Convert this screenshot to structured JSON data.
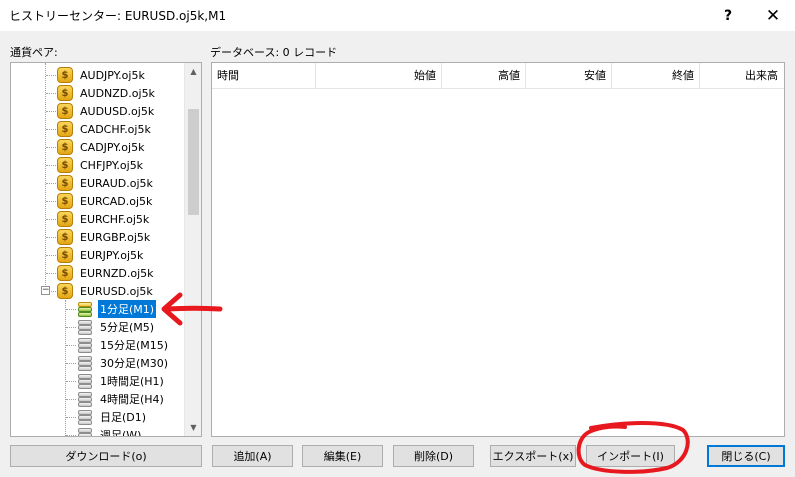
{
  "window": {
    "title": "ヒストリーセンター: EURUSD.oj5k,M1",
    "help_glyph": "?",
    "close_glyph": "✕"
  },
  "left_panel": {
    "label": "通貨ペア:",
    "symbols": [
      "AUDJPY.oj5k",
      "AUDNZD.oj5k",
      "AUDUSD.oj5k",
      "CADCHF.oj5k",
      "CADJPY.oj5k",
      "CHFJPY.oj5k",
      "EURAUD.oj5k",
      "EURCAD.oj5k",
      "EURCHF.oj5k",
      "EURGBP.oj5k",
      "EURJPY.oj5k",
      "EURNZD.oj5k",
      "EURUSD.oj5k"
    ],
    "coin_glyph": "$",
    "expanded_toggle": "−",
    "timeframes": [
      "1分足(M1)",
      "5分足(M5)",
      "15分足(M15)",
      "30分足(M30)",
      "1時間足(H1)",
      "4時間足(H4)",
      "日足(D1)",
      "週足(W)"
    ],
    "selected_timeframe": "1分足(M1)"
  },
  "right_panel": {
    "label": "データベース: 0 レコード",
    "columns": [
      "時間",
      "始値",
      "高値",
      "安値",
      "終値",
      "出来高"
    ]
  },
  "buttons": {
    "download": "ダウンロード(o)",
    "add": "追加(A)",
    "edit": "編集(E)",
    "delete": "削除(D)",
    "export": "エクスポート(x)",
    "import": "インポート(I)",
    "close": "閉じる(C)"
  },
  "scrollbar": {
    "up_glyph": "▲",
    "down_glyph": "▼"
  },
  "colors": {
    "selection": "#0078d7",
    "annotation": "#e8191e"
  }
}
